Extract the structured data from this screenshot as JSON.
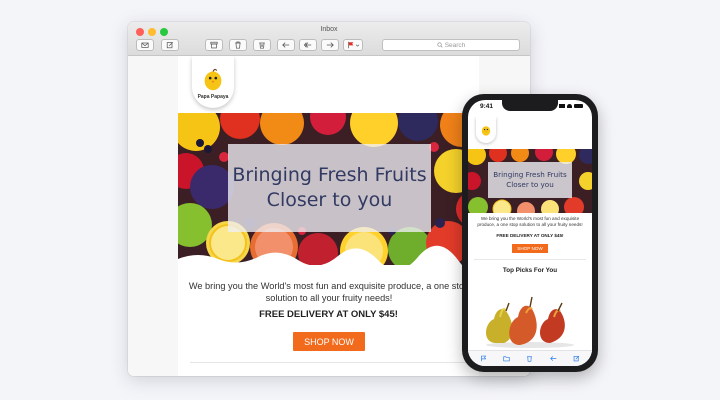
{
  "desktop": {
    "window_title": "Inbox",
    "search_placeholder": "Search",
    "email": {
      "logo_text": "Papa Papaya",
      "hero_title_line1": "Bringing Fresh Fruits",
      "hero_title_line2": "Closer to you",
      "body_copy": "We bring you the World's most fun and exquisite produce, a one stop solution to all your fruity needs!",
      "delivery": "FREE DELIVERY AT ONLY $45!",
      "shop_button": "SHOP NOW"
    }
  },
  "phone": {
    "status_time": "9:41",
    "email": {
      "hero_title_line1": "Bringing Fresh Fruits",
      "hero_title_line2": "Closer to you",
      "body_copy": "We bring you the World's most fun and exquisite produce, a one stop solution to all your fruity needs!",
      "delivery": "FREE DELIVERY AT ONLY $45!",
      "shop_button": "SHOP NOW",
      "section_title": "Top Picks For You"
    }
  },
  "colors": {
    "accent": "#f26a1b",
    "hero_text": "#323a63",
    "flag": "#e0302a"
  },
  "icons": {
    "toolbar": [
      "compose-icon",
      "edit-icon",
      "archive-icon",
      "trash-icon",
      "junk-icon",
      "reply-icon",
      "reply-all-icon",
      "forward-icon",
      "flag-icon"
    ],
    "phone_tabbar": [
      "flag-icon",
      "folder-icon",
      "trash-icon",
      "reply-icon",
      "compose-icon"
    ]
  }
}
